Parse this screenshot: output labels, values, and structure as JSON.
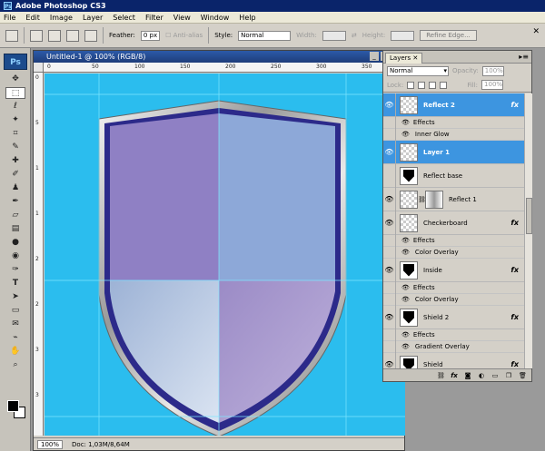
{
  "app": {
    "title": "Adobe Photoshop CS3",
    "logo": "Ps"
  },
  "menu": [
    "File",
    "Edit",
    "Image",
    "Layer",
    "Select",
    "Filter",
    "View",
    "Window",
    "Help"
  ],
  "options": {
    "feather_label": "Feather:",
    "feather_value": "0 px",
    "antialias_label": "Anti-alias",
    "style_label": "Style:",
    "style_value": "Normal",
    "width_label": "Width:",
    "height_label": "Height:",
    "refine_edge_label": "Refine Edge..."
  },
  "document": {
    "title": "Untitled-1 @ 100% (RGB/8)",
    "zoom": "100%",
    "doc_info": "Doc: 1,03M/8,64M",
    "ruler_h": [
      "0",
      "50",
      "100",
      "150",
      "200",
      "250",
      "300",
      "350"
    ],
    "ruler_v": [
      "0",
      "5",
      "1",
      "1",
      "2",
      "2",
      "3",
      "3"
    ],
    "canvas_color": "#2bbdee"
  },
  "layers_panel": {
    "tab_label": "Layers",
    "blend_mode": "Normal",
    "opacity_label": "Opacity:",
    "opacity_value": "100%",
    "lock_label": "Lock:",
    "fill_label": "Fill:",
    "fill_value": "100%",
    "accent_color": "#3d95e0",
    "rows": [
      {
        "kind": "layer",
        "name": "Reflect 2",
        "selected": true,
        "visible": true,
        "fx": true,
        "thumb": "checker"
      },
      {
        "kind": "effects",
        "label": "Effects"
      },
      {
        "kind": "effect",
        "label": "Inner Glow"
      },
      {
        "kind": "layer",
        "name": "Layer 1",
        "selected": true,
        "visible": true,
        "fx": false,
        "thumb": "checker"
      },
      {
        "kind": "layer",
        "name": "Reflect base",
        "selected": false,
        "visible": false,
        "fx": false,
        "thumb": "shield"
      },
      {
        "kind": "layer",
        "name": "Reflect 1",
        "selected": false,
        "visible": true,
        "fx": false,
        "thumb": "checker",
        "mask": true
      },
      {
        "kind": "layer",
        "name": "Checkerboard",
        "selected": false,
        "visible": true,
        "fx": true,
        "thumb": "checker"
      },
      {
        "kind": "effects",
        "label": "Effects"
      },
      {
        "kind": "effect",
        "label": "Color Overlay"
      },
      {
        "kind": "layer",
        "name": "Inside",
        "selected": false,
        "visible": true,
        "fx": true,
        "thumb": "shield"
      },
      {
        "kind": "effects",
        "label": "Effects"
      },
      {
        "kind": "effect",
        "label": "Color Overlay"
      },
      {
        "kind": "layer",
        "name": "Shield 2",
        "selected": false,
        "visible": true,
        "fx": true,
        "thumb": "shield"
      },
      {
        "kind": "effects",
        "label": "Effects"
      },
      {
        "kind": "effect",
        "label": "Gradient Overlay"
      },
      {
        "kind": "layer",
        "name": "Shield",
        "selected": false,
        "visible": true,
        "fx": true,
        "thumb": "shield"
      }
    ],
    "fx_label": "fx"
  },
  "toolbox": [
    "move-tool",
    "marquee-tool",
    "lasso-tool",
    "magic-wand-tool",
    "crop-tool",
    "slice-tool",
    "healing-tool",
    "brush-tool",
    "clone-stamp-tool",
    "history-brush-tool",
    "eraser-tool",
    "gradient-tool",
    "blur-tool",
    "dodge-tool",
    "pen-tool",
    "type-tool",
    "path-select-tool",
    "shape-tool",
    "notes-tool",
    "eyedropper-tool",
    "hand-tool",
    "zoom-tool"
  ]
}
